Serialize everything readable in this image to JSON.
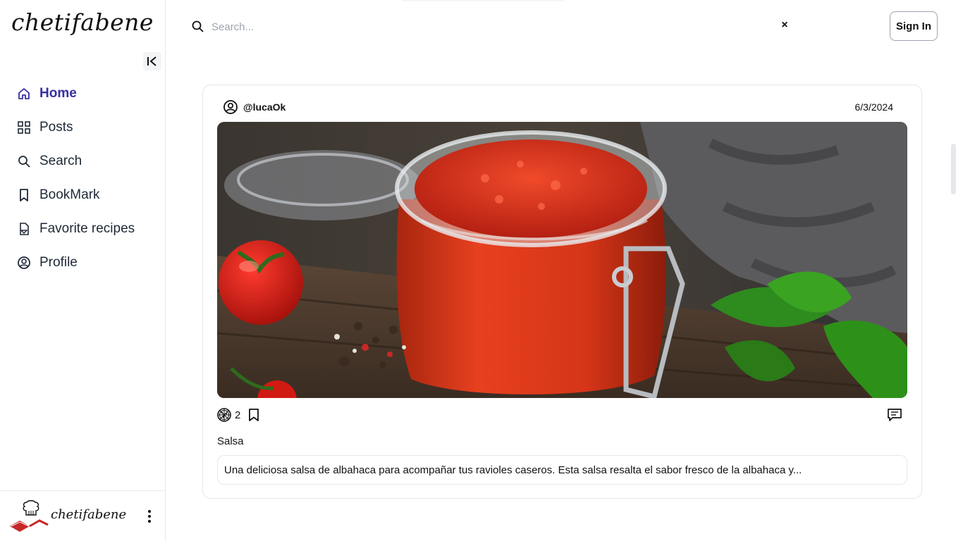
{
  "brand": {
    "name": "chetifabene"
  },
  "nav": {
    "items": [
      {
        "label": "Home",
        "icon": "home-icon",
        "active": true
      },
      {
        "label": "Posts",
        "icon": "grid-icon",
        "active": false
      },
      {
        "label": "Search",
        "icon": "search-icon",
        "active": false
      },
      {
        "label": "BookMark",
        "icon": "bookmark-icon",
        "active": false
      },
      {
        "label": "Favorite recipes",
        "icon": "recipe-icon",
        "active": false
      },
      {
        "label": "Profile",
        "icon": "user-circle-icon",
        "active": false
      }
    ]
  },
  "footer": {
    "brand": "chetifabene"
  },
  "search": {
    "placeholder": "Search...",
    "clear_label": "×"
  },
  "header": {
    "signin_label": "Sign In"
  },
  "post": {
    "username": "@lucaOk",
    "date": "6/3/2024",
    "likes": "2",
    "title": "Salsa",
    "description": "Una deliciosa salsa de albahaca para acompañar tus ravioles caseros. Esta salsa resalta el sabor fresco de la albahaca y..."
  },
  "colors": {
    "accent": "#3730a3",
    "border": "#e5e7eb"
  }
}
